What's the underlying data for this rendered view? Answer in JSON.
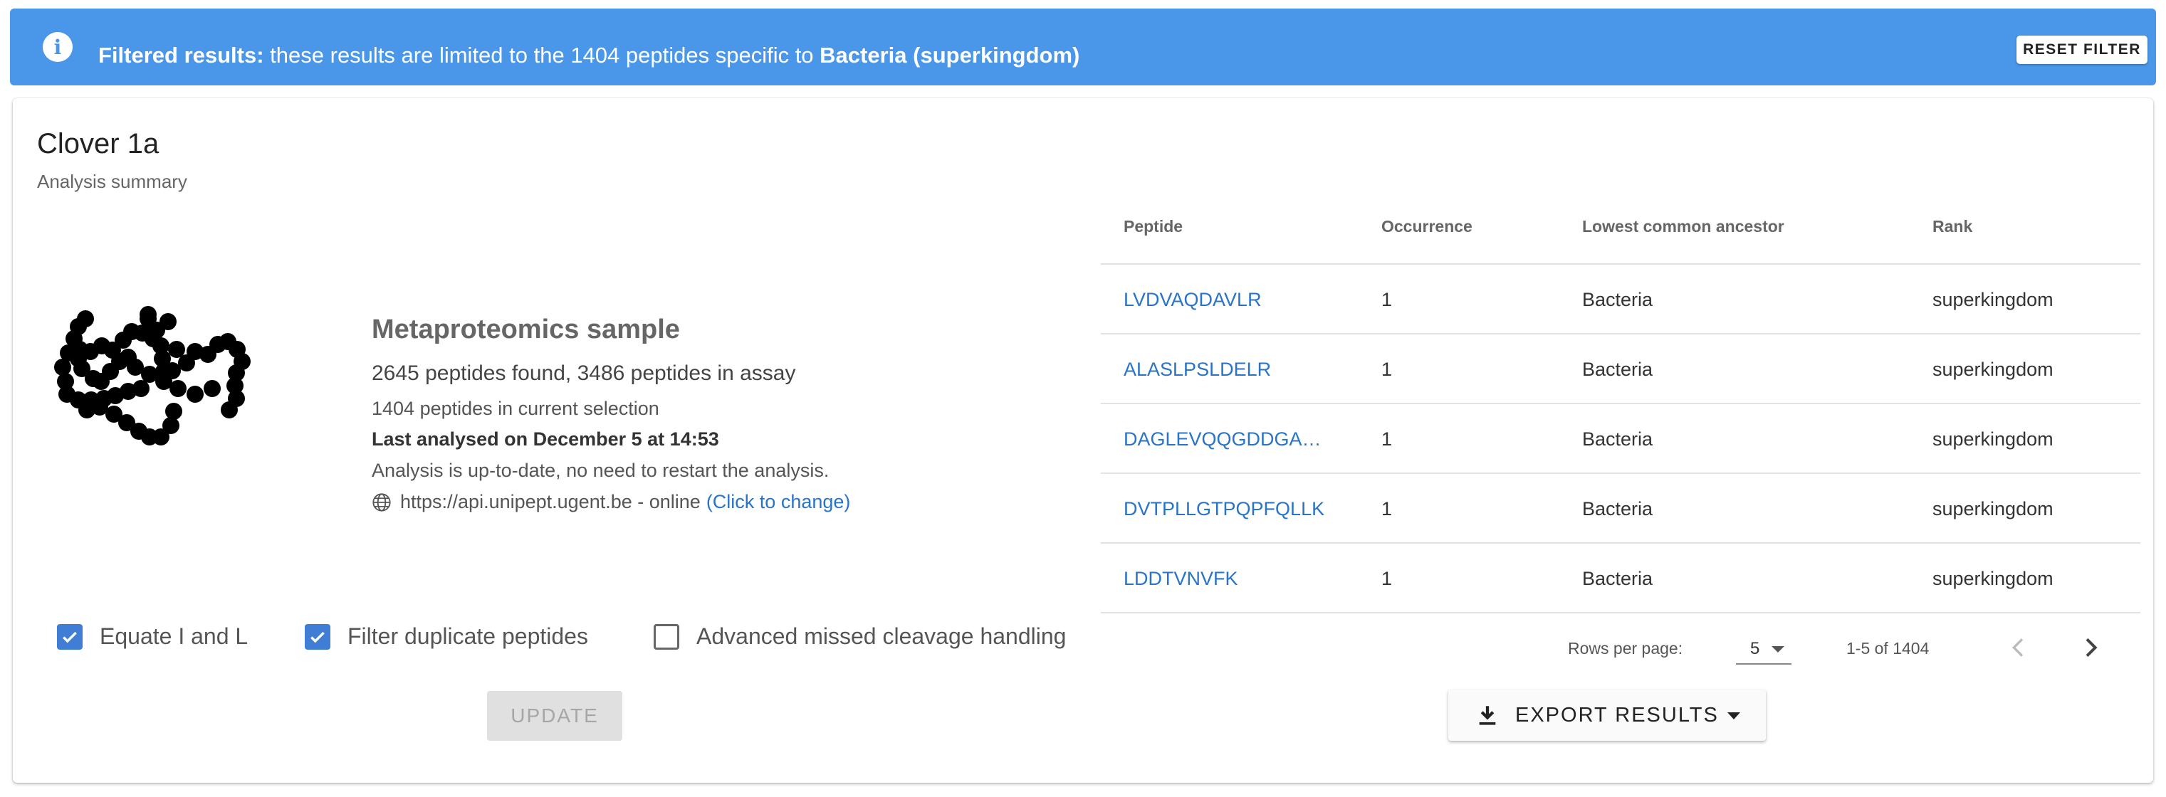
{
  "banner": {
    "icon": "info-icon",
    "icon_glyph": "i",
    "lead": "Filtered results:",
    "text": " these results are limited to the 1404 peptides specific to ",
    "taxon": "Bacteria (superkingdom)",
    "reset_label": "RESET FILTER",
    "color": "#4a96e8"
  },
  "card": {
    "title": "Clover 1a",
    "subtitle": "Analysis summary"
  },
  "summary": {
    "sample_type": "Metaproteomics sample",
    "peptides_found": "2645 peptides found, 3486 peptides in assay",
    "selection": "1404 peptides in current selection",
    "last_analysed": "Last analysed on December 5 at 14:53",
    "status": "Analysis is up-to-date, no need to restart the analysis.",
    "endpoint": "https://api.unipept.ugent.be - online",
    "change_link": "(Click to change)"
  },
  "options": {
    "equate_il": {
      "label": "Equate I and L",
      "checked": true
    },
    "filter_duplicates": {
      "label": "Filter duplicate peptides",
      "checked": true
    },
    "missed_cleavage": {
      "label": "Advanced missed cleavage handling",
      "checked": false
    },
    "update_label": "UPDATE"
  },
  "table": {
    "headers": [
      "Peptide",
      "Occurrence",
      "Lowest common ancestor",
      "Rank"
    ],
    "rows": [
      [
        "LVDVAQDAVLR",
        "1",
        "Bacteria",
        "superkingdom"
      ],
      [
        "ALASLPSLDELR",
        "1",
        "Bacteria",
        "superkingdom"
      ],
      [
        "DAGLEVQQGDDGA…",
        "1",
        "Bacteria",
        "superkingdom"
      ],
      [
        "DVTPLLGTPQPFQLLK",
        "1",
        "Bacteria",
        "superkingdom"
      ],
      [
        "LDDTVNVFK",
        "1",
        "Bacteria",
        "superkingdom"
      ]
    ]
  },
  "pagination": {
    "rows_per_page_label": "Rows per page:",
    "rows_per_page": "5",
    "range": "1-5 of 1404"
  },
  "export": {
    "label": "EXPORT RESULTS",
    "icon": "download-icon"
  },
  "colors": {
    "accent": "#3f7ed4",
    "link": "#2a74c8"
  }
}
